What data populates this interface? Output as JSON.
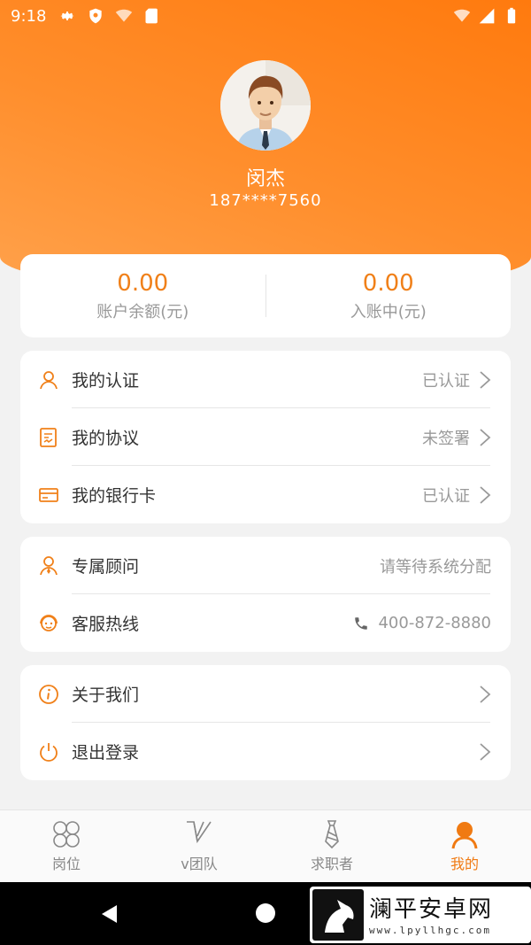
{
  "status_bar": {
    "time": "9:18"
  },
  "profile": {
    "name": "闵杰",
    "phone": "187****7560"
  },
  "balance": {
    "account_balance_value": "0.00",
    "account_balance_label": "账户余额(元)",
    "pending_value": "0.00",
    "pending_label": "入账中(元)"
  },
  "menu_group_1": [
    {
      "label": "我的认证",
      "value": "已认证",
      "icon": "user-outline-icon"
    },
    {
      "label": "我的协议",
      "value": "未签署",
      "icon": "document-edit-icon"
    },
    {
      "label": "我的银行卡",
      "value": "已认证",
      "icon": "bank-card-icon"
    }
  ],
  "menu_group_2": [
    {
      "label": "专属顾问",
      "value": "请等待系统分配",
      "icon": "advisor-icon"
    },
    {
      "label": "客服热线",
      "value": "400-872-8880",
      "icon": "customer-service-icon"
    }
  ],
  "menu_group_3": [
    {
      "label": "关于我们",
      "icon": "info-icon"
    },
    {
      "label": "退出登录",
      "icon": "power-icon"
    }
  ],
  "tabs": [
    {
      "label": "岗位",
      "icon": "clover-icon",
      "active": false
    },
    {
      "label": "v团队",
      "icon": "v-team-icon",
      "active": false
    },
    {
      "label": "求职者",
      "icon": "tie-icon",
      "active": false
    },
    {
      "label": "我的",
      "icon": "person-icon",
      "active": true
    }
  ],
  "watermark": {
    "title": "澜平安卓网",
    "url": "www.lpyllhgc.com"
  },
  "colors": {
    "accent": "#f07a12",
    "header": "#ff8a24",
    "muted_text": "#999999"
  }
}
